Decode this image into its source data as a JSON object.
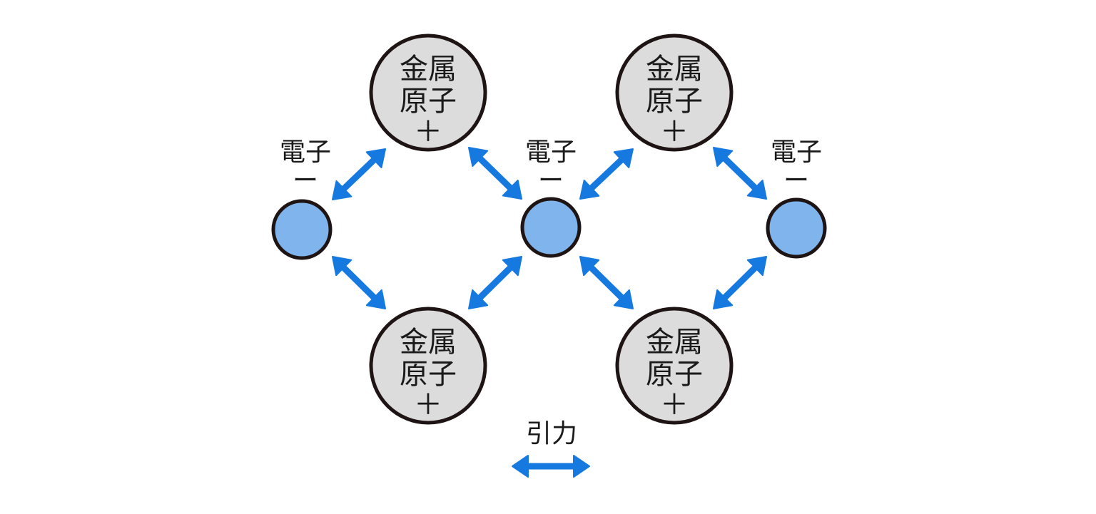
{
  "atom": {
    "line1": "金属",
    "line2": "原子",
    "charge": "＋"
  },
  "electron": {
    "name": "電子",
    "charge": "ー"
  },
  "legend": {
    "label": "引力"
  },
  "colors": {
    "atom_fill": "#dcdcdc",
    "electron_fill": "#7fb4ec",
    "arrow": "#1679e0",
    "outline": "#1e1414",
    "background": "#ffffff"
  }
}
